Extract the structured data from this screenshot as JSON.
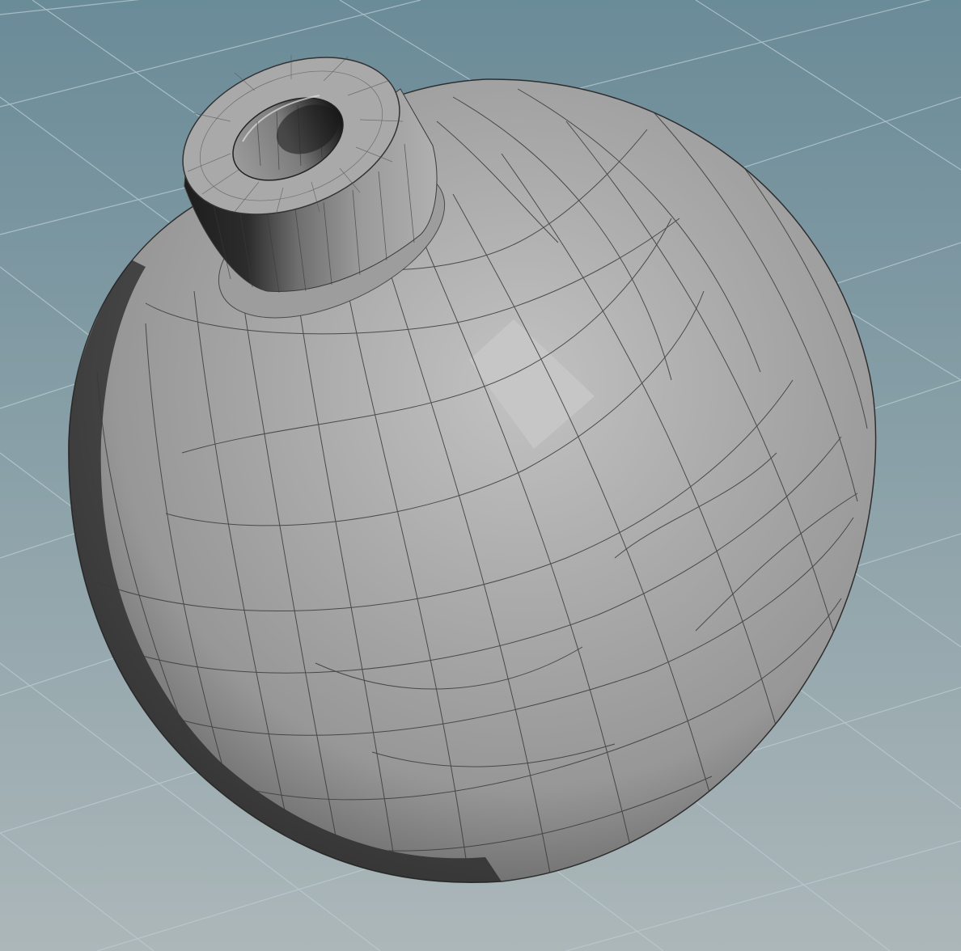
{
  "viewport": {
    "background_top": "#6a8b98",
    "background_bottom": "#acb7b9",
    "grid_color": "#b9cbd2",
    "model_color": "#a7a7a7",
    "model_highlight": "#c2c2c2",
    "model_shadow": "#1c1c1c",
    "wire_color": "#3a3a3a"
  }
}
